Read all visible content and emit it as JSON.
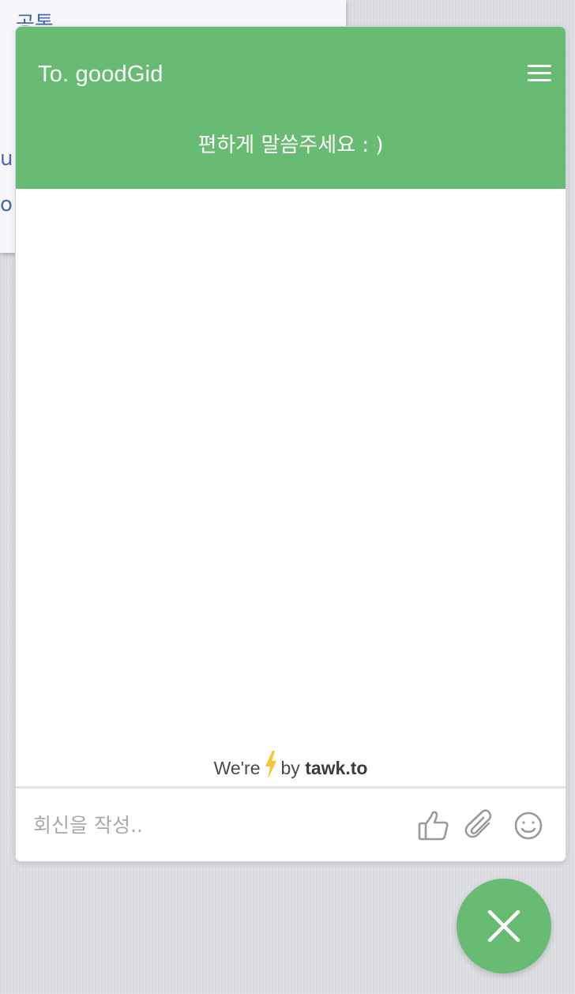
{
  "background": {
    "heading_fragment": "공통",
    "text_fragment_1": "u",
    "text_fragment_2": "o"
  },
  "chat": {
    "title": "To. goodGid",
    "subtitle": "편하게 말씀주세요 : )",
    "branding": {
      "prefix": "We're",
      "middle": "by",
      "brand": "tawk.to"
    },
    "input_placeholder": "회신을 작성..",
    "icons": {
      "menu": "hamburger-menu-icon",
      "like": "thumbs-up-icon",
      "attach": "paperclip-icon",
      "emoji": "smiley-icon",
      "close": "close-icon",
      "bolt": "lightning-bolt-icon"
    },
    "colors": {
      "brand_green": "#68bb73",
      "bolt_yellow": "#f7c531"
    }
  }
}
